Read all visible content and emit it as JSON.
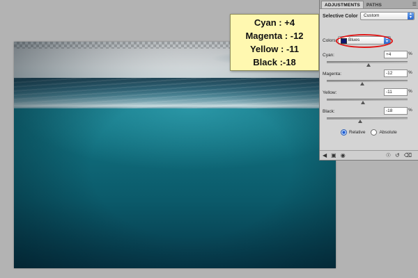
{
  "callout": {
    "lines": [
      "Cyan : +4",
      "Magenta : -12",
      "Yellow : -11",
      "Black :-18"
    ]
  },
  "panel": {
    "tabs": [
      {
        "label": "ADJUSTMENTS",
        "active": true
      },
      {
        "label": "PATHS",
        "active": false
      }
    ],
    "title": "Selective Color",
    "preset": {
      "value": "Custom"
    },
    "colors": {
      "label": "Colors:",
      "value": "Blues",
      "swatch": "#0b1670",
      "highlight": "#e01818"
    },
    "sliders": [
      {
        "label": "Cyan:",
        "value": "+4",
        "unit": "%",
        "level": 4
      },
      {
        "label": "Magenta:",
        "value": "-12",
        "unit": "%",
        "level": -12
      },
      {
        "label": "Yellow:",
        "value": "-11",
        "unit": "%",
        "level": -11
      },
      {
        "label": "Black:",
        "value": "-18",
        "unit": "%",
        "level": -18
      }
    ],
    "method": {
      "options": [
        {
          "label": "Relative",
          "selected": true
        },
        {
          "label": "Absolute",
          "selected": false
        }
      ]
    },
    "footer_icons": [
      "back-arrow-icon",
      "clip-layer-icon",
      "visibility-eye-icon",
      "view-previous-icon",
      "reset-icon",
      "delete-icon"
    ]
  }
}
